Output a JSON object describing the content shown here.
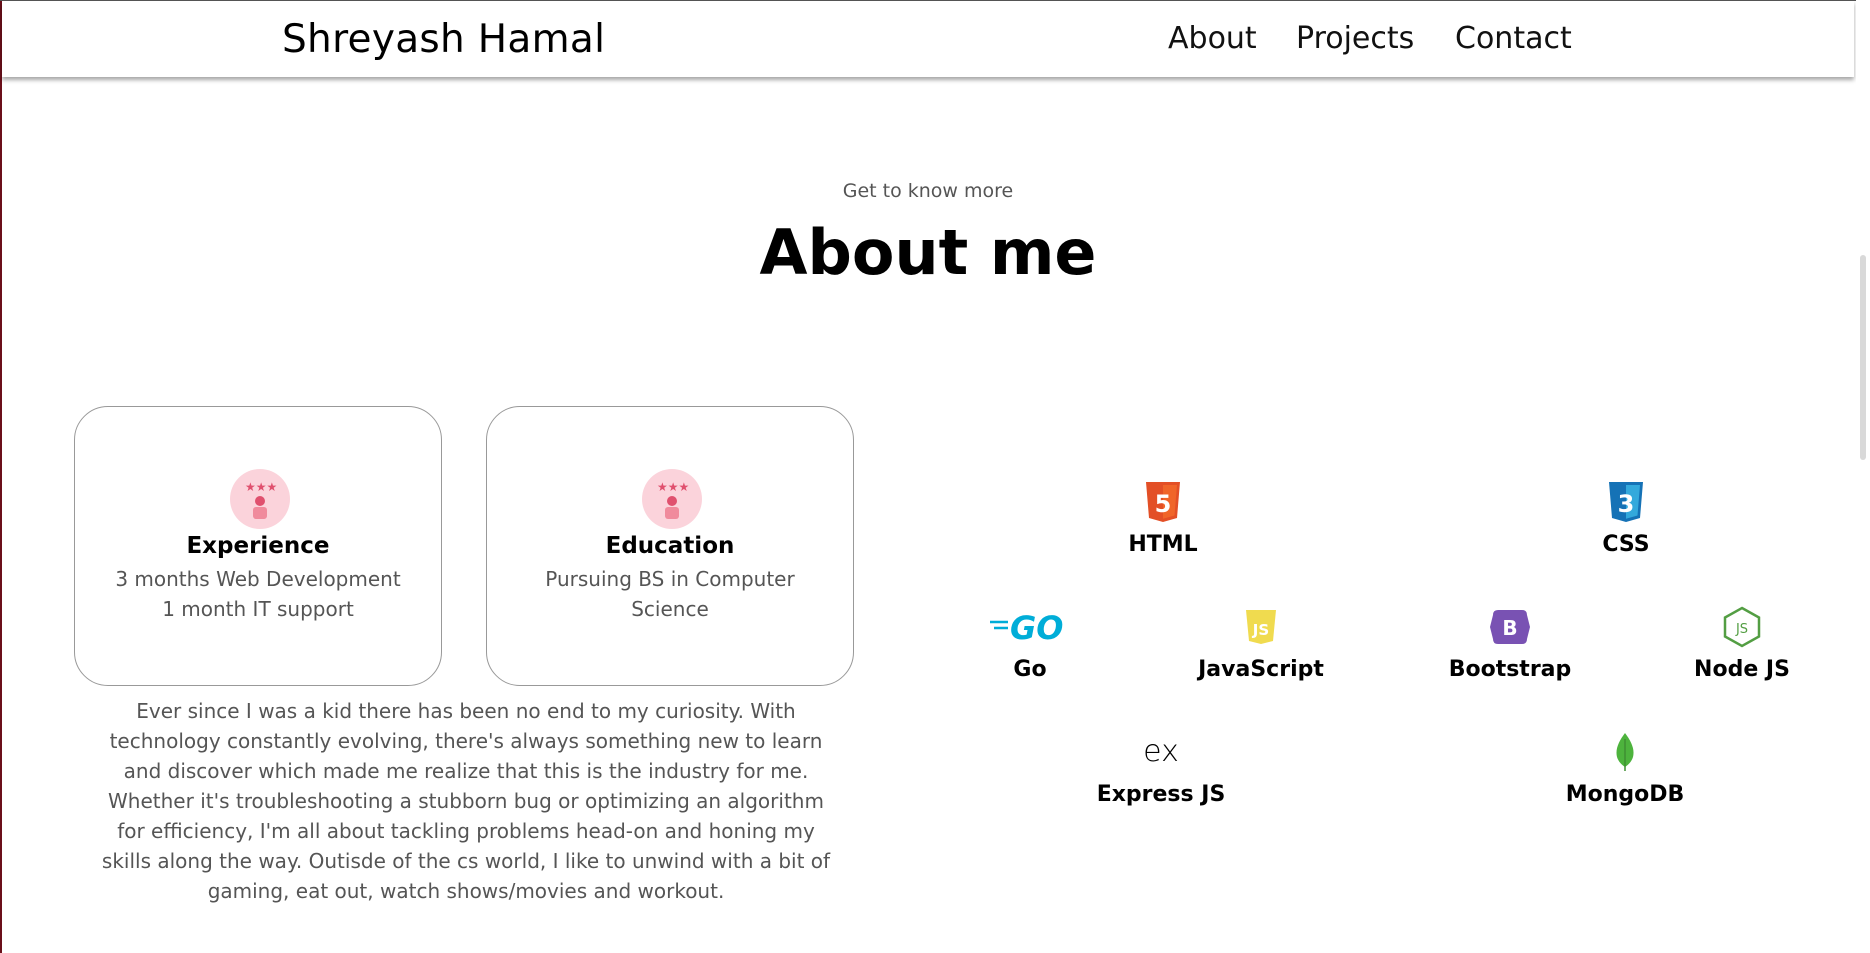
{
  "nav": {
    "brand": "Shreyash Hamal",
    "links": [
      "About",
      "Projects",
      "Contact"
    ]
  },
  "section": {
    "subtitle": "Get to know more",
    "title": "About me"
  },
  "cards": [
    {
      "title": "Experience",
      "lines": [
        "3 months Web Development",
        "1 month IT support"
      ],
      "icon": "experience-icon"
    },
    {
      "title": "Education",
      "lines": [
        "Pursuing BS in Computer",
        "Science"
      ],
      "icon": "education-icon"
    }
  ],
  "about_text": "Ever since I was a kid there has been no end to my curiosity. With technology constantly evolving, there's always something new to learn and discover which made me realize that this is the industry for me. Whether it's troubleshooting a stubborn bug or optimizing an algorithm for efficiency, I'm all about tackling problems head-on and honing my skills along the way. Outisde of the cs world, I like to unwind with a bit of gaming, eat out, watch shows/movies and workout.",
  "skills": [
    {
      "label": "HTML",
      "icon": "html5-icon",
      "color": "#e34f26"
    },
    {
      "label": "CSS",
      "icon": "css3-icon",
      "color": "#1572b6"
    },
    {
      "label": "Go",
      "icon": "go-icon",
      "color": "#00add8"
    },
    {
      "label": "JavaScript",
      "icon": "javascript-icon",
      "color": "#f0db4f"
    },
    {
      "label": "Bootstrap",
      "icon": "bootstrap-icon",
      "color": "#7952b3"
    },
    {
      "label": "Node JS",
      "icon": "nodejs-icon",
      "color": "#539e43"
    },
    {
      "label": "Express JS",
      "icon": "express-icon",
      "color": "#000000"
    },
    {
      "label": "MongoDB",
      "icon": "mongodb-icon",
      "color": "#4db33d"
    }
  ],
  "colors": {
    "card_border": "#999999",
    "muted_text": "#555555",
    "icon_bg": "#fbd3db",
    "icon_accent": "#e0506e"
  }
}
